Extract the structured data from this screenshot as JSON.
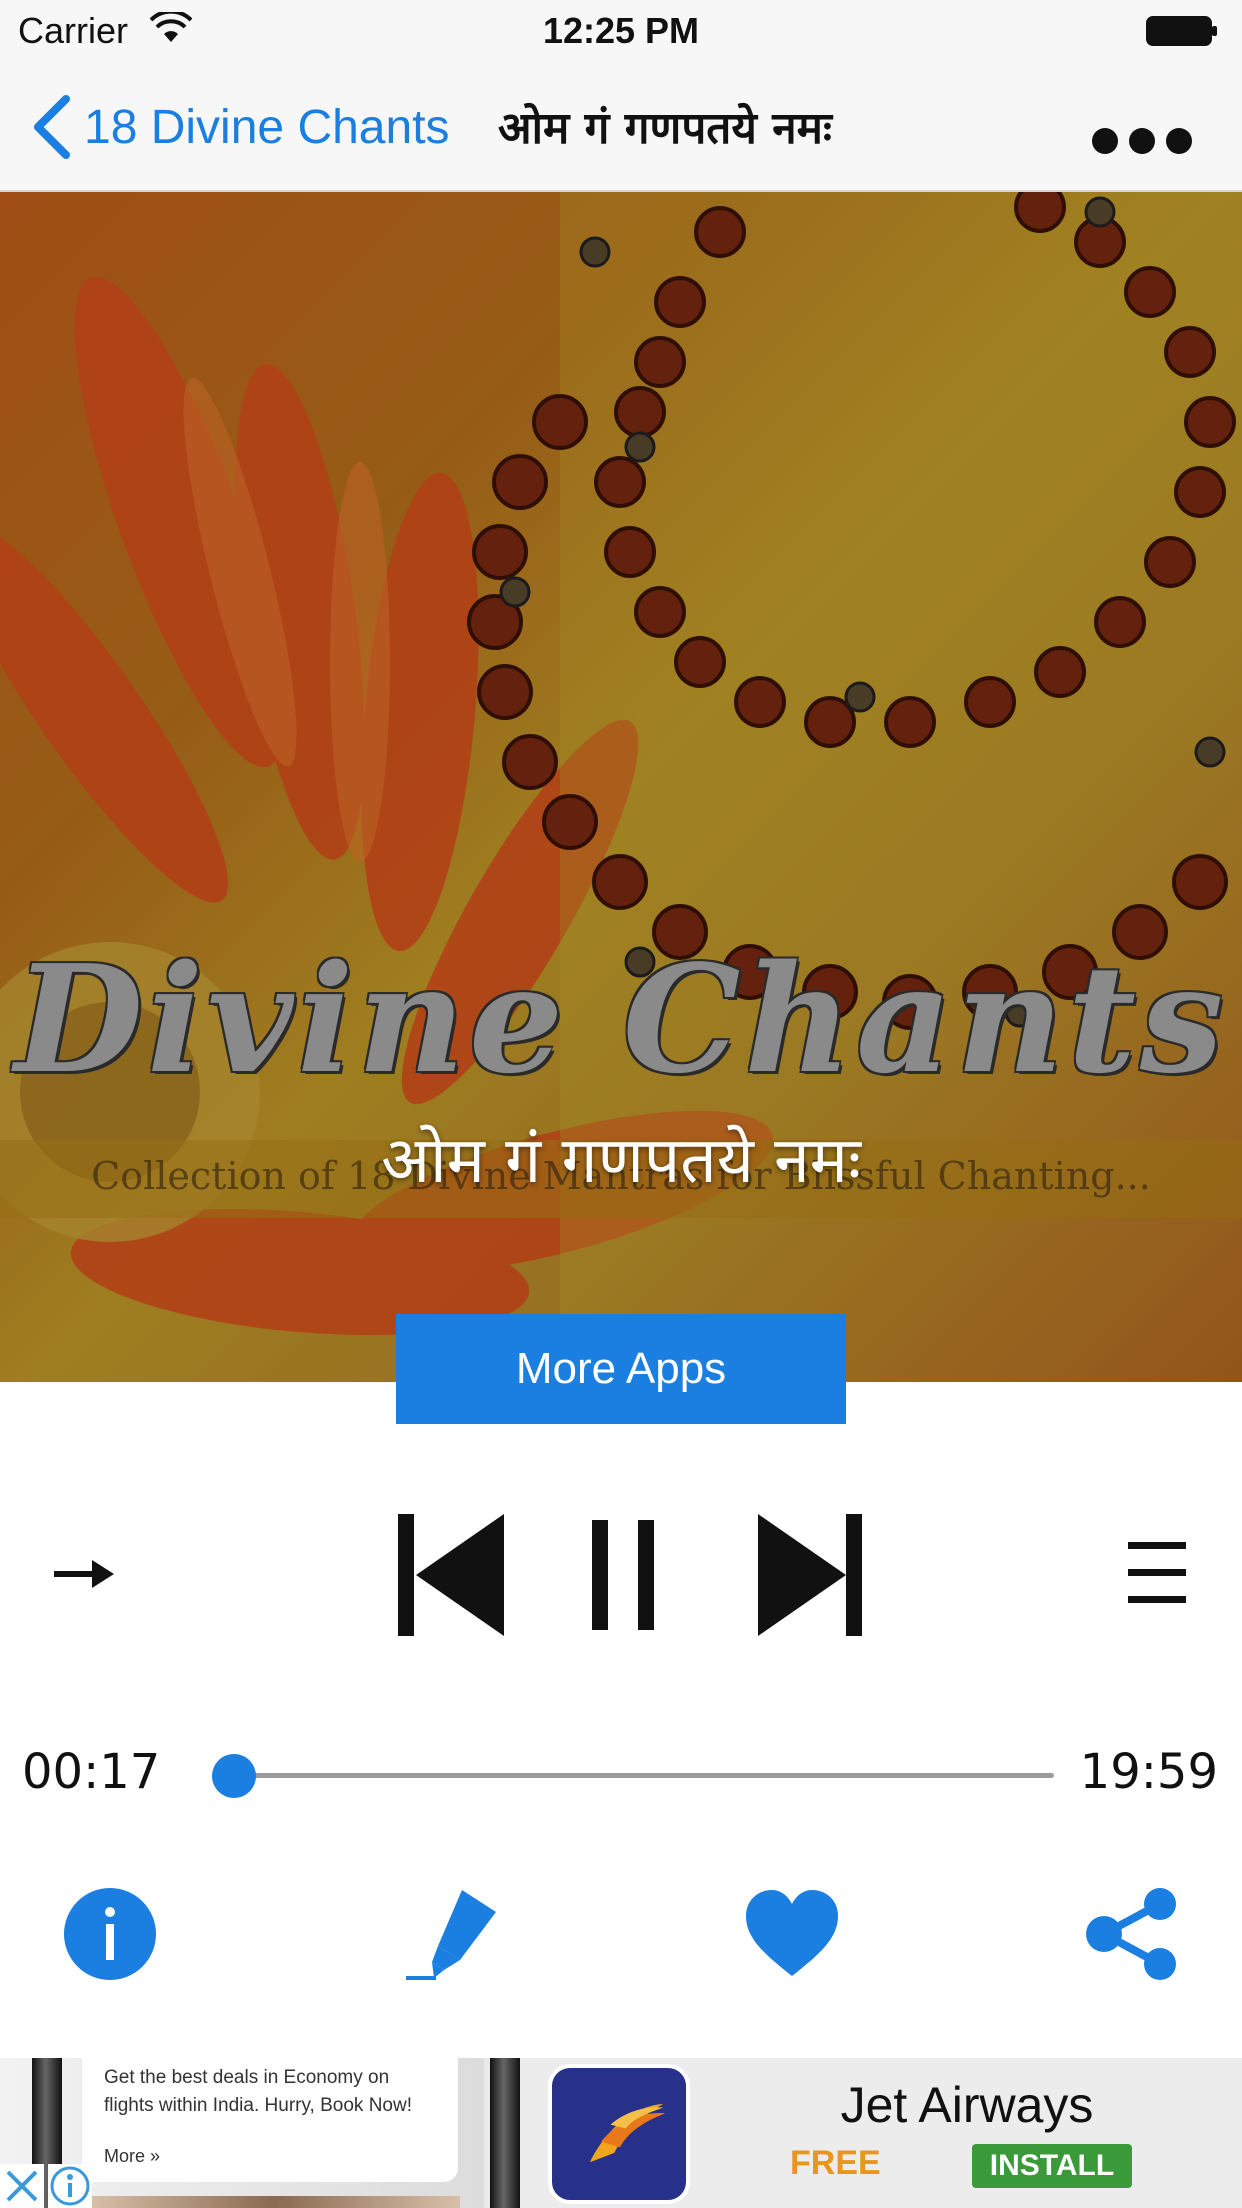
{
  "status_bar": {
    "carrier": "Carrier",
    "time": "12:25 PM"
  },
  "nav": {
    "back_label": "18 Divine Chants",
    "title": "ओम गं गणपतये नमः",
    "more_icon": "ellipsis-icon"
  },
  "cover": {
    "logo_text": "Divine Chants",
    "tagline": "Collection of 18 Divine Mantras for Blissful Chanting...",
    "mantra_overlay": "ओम गं गणपतये नमः"
  },
  "more_apps_label": "More Apps",
  "controls": {
    "repeat_icon": "arrow-right-icon",
    "prev_icon": "skip-previous-icon",
    "play_pause_icon": "pause-icon",
    "next_icon": "skip-next-icon",
    "playlist_icon": "menu-icon"
  },
  "progress": {
    "elapsed": "00:17",
    "total": "19:59",
    "fraction": 0.014
  },
  "actions": [
    {
      "name": "info",
      "icon": "info-icon"
    },
    {
      "name": "highlight",
      "icon": "highlighter-pen-icon"
    },
    {
      "name": "favorite",
      "icon": "heart-icon"
    },
    {
      "name": "share",
      "icon": "share-icon"
    }
  ],
  "ad": {
    "left_text": "Get the best deals in Economy on flights within India. Hurry, Book Now!",
    "left_more": "More »",
    "brand": "Jet Airways",
    "price": "FREE",
    "install": "INSTALL"
  },
  "colors": {
    "accent": "#1a7fe0",
    "install_green": "#3a9a3a",
    "free_orange": "#e8961e"
  }
}
